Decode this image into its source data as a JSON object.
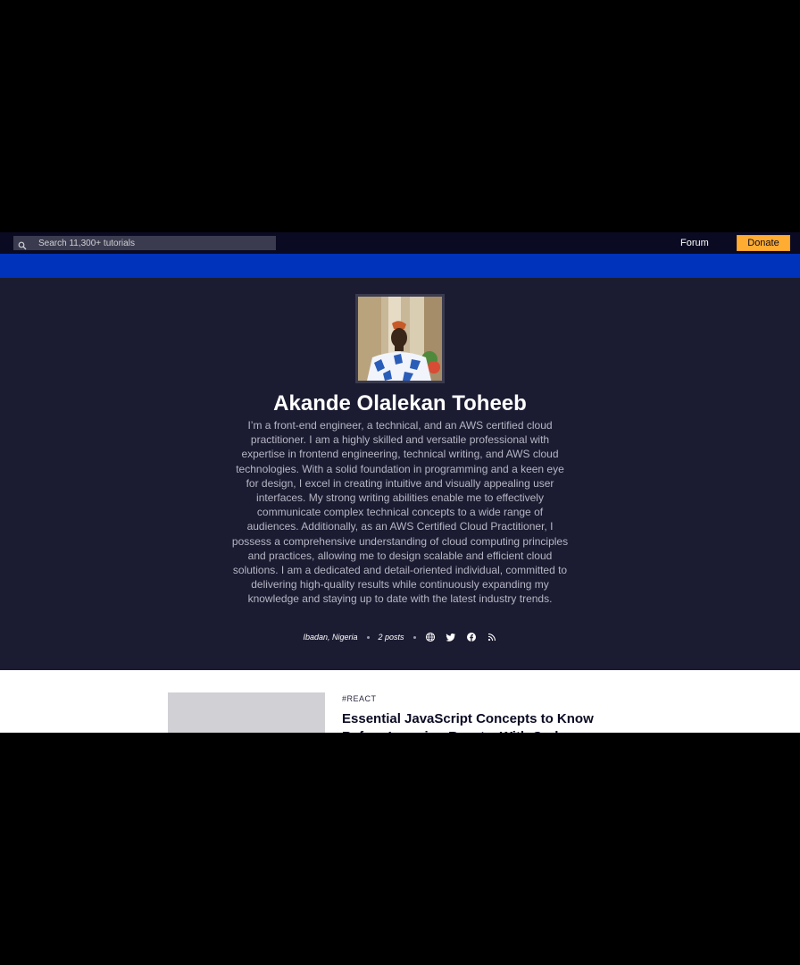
{
  "search": {
    "placeholder": "Search 11,300+ tutorials"
  },
  "nav": {
    "forum": "Forum",
    "donate": "Donate"
  },
  "author": {
    "name": "Akande Olalekan Toheeb",
    "bio": "I’m a front-end engineer, a technical, and an AWS certified cloud practitioner. I am a highly skilled and versatile professional with expertise in frontend engineering, technical writing, and AWS cloud technologies. With a solid foundation in programming and a keen eye for design, I excel in creating intuitive and visually appealing user interfaces. My strong writing abilities enable me to effectively communicate complex technical concepts to a wide range of audiences. Additionally, as an AWS Certified Cloud Practitioner, I possess a comprehensive understanding of cloud computing principles and practices, allowing me to design scalable and efficient cloud solutions. I am a dedicated and detail-oriented individual, committed to delivering high-quality results while continuously expanding my knowledge and staying up to date with the latest industry trends.",
    "location": "Ibadan, Nigeria",
    "post_count": "2 posts",
    "social_icons": [
      "globe-icon",
      "twitter-icon",
      "facebook-icon",
      "rss-icon"
    ]
  },
  "posts": [
    {
      "tag": "#REACT",
      "title": "Essential JavaScript Concepts to Know Before Learning React – With Code"
    }
  ],
  "colors": {
    "nav_bg": "#0a0a23",
    "banner": "#0033bb",
    "profile_bg": "#1b1b32",
    "donate": "#feac32"
  }
}
